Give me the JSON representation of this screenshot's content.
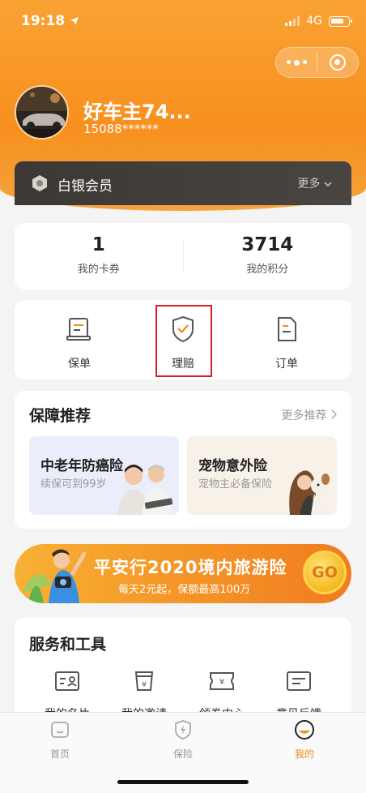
{
  "status_bar": {
    "time": "19:18",
    "network": "4G",
    "icons": [
      "location-arrow-icon",
      "signal-icon",
      "battery-icon"
    ]
  },
  "capsule": {
    "icons": [
      "more-dots-icon",
      "target-circle-icon"
    ]
  },
  "profile": {
    "name": "好车主74...",
    "phone": "15088******"
  },
  "membership": {
    "level": "白银会员",
    "more": "更多"
  },
  "stats": [
    {
      "value": "1",
      "label": "我的卡券"
    },
    {
      "value": "3714",
      "label": "我的积分"
    }
  ],
  "quick_actions": [
    {
      "label": "保单",
      "icon": "policy-document-icon"
    },
    {
      "label": "理赔",
      "icon": "shield-check-icon"
    },
    {
      "label": "订单",
      "icon": "order-icon"
    }
  ],
  "recommend": {
    "title": "保障推荐",
    "more": "更多推荐",
    "items": [
      {
        "name": "中老年防癌险",
        "sub": "续保可到99岁"
      },
      {
        "name": "宠物意外险",
        "sub": "宠物主必备保险"
      }
    ]
  },
  "banner": {
    "title": "平安行2020境内旅游险",
    "subtitle": "每天2元起，保额最高100万",
    "go": "GO"
  },
  "tools": {
    "title": "服务和工具",
    "items": [
      {
        "label": "我的名片",
        "icon": "business-card-icon"
      },
      {
        "label": "我的邀请",
        "icon": "invite-cup-icon"
      },
      {
        "label": "领券中心",
        "icon": "coupon-icon"
      },
      {
        "label": "意见反馈",
        "icon": "feedback-icon"
      }
    ]
  },
  "tabbar": [
    {
      "label": "首页",
      "icon": "home-icon"
    },
    {
      "label": "保险",
      "icon": "insurance-shield-icon"
    },
    {
      "label": "我的",
      "icon": "profile-smile-icon"
    }
  ],
  "colors": {
    "accent": "#f7901f",
    "active_tab": "#f08c1a",
    "highlight": "#d71f24"
  }
}
